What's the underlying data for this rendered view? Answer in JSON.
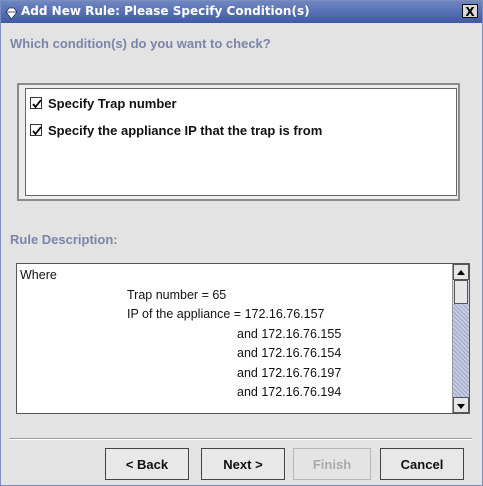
{
  "window": {
    "title": "Add New Rule: Please Specify Condition(s)",
    "close_label": "X"
  },
  "conditions_section": {
    "question": "Which condition(s) do you want to check?",
    "items": [
      {
        "label": "Specify Trap number",
        "checked": true
      },
      {
        "label": "Specify the appliance IP that the trap is from",
        "checked": true
      }
    ]
  },
  "rule_description": {
    "heading": "Rule Description:",
    "where": "Where",
    "trap_line": "Trap number = 65",
    "ip_line": "IP of the appliance = 172.16.76.157",
    "and_lines": [
      "and 172.16.76.155",
      "and 172.16.76.154",
      "and 172.16.76.197",
      "and 172.16.76.194"
    ]
  },
  "buttons": {
    "back": "< Back",
    "next": "Next >",
    "finish": "Finish",
    "cancel": "Cancel"
  },
  "colors": {
    "title_bar": "#3f59a4",
    "section_label": "#7a85a8",
    "window_bg": "#e3e3e3"
  },
  "icons": {
    "title": "gem-icon",
    "close": "close-icon",
    "check": "check-icon",
    "scroll_up": "arrow-up-icon",
    "scroll_down": "arrow-down-icon"
  }
}
